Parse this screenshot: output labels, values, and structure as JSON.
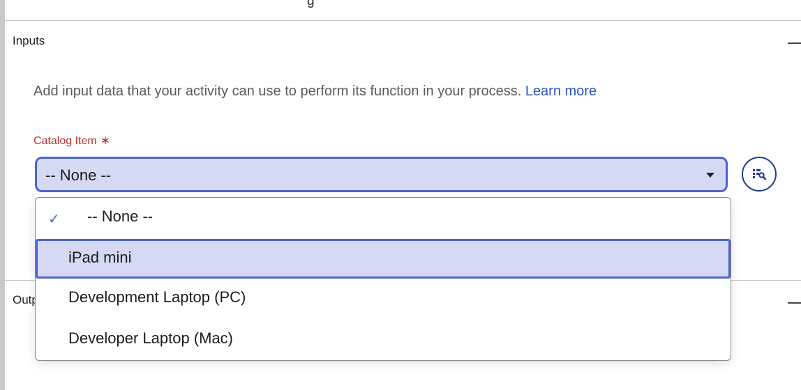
{
  "header": {
    "title_fragment": "g"
  },
  "inputs_section": {
    "title": "Inputs",
    "description": "Add input data that your activity can use to perform its function in your process.",
    "learn_more": "Learn more",
    "field": {
      "label": "Catalog Item",
      "required_mark": "∗",
      "selected_value": "-- None --",
      "options": [
        "-- None --",
        "iPad mini",
        "Development Laptop (PC)",
        "Developer Laptop (Mac)"
      ],
      "checked_index": 0,
      "highlighted_index": 1
    },
    "picker_button_icon": "data-pill-picker-icon"
  },
  "outputs_section": {
    "title": "Outputs"
  },
  "colors": {
    "accent": "#4d63cf",
    "selection_fill": "#d5d9f3",
    "required": "#b3302f",
    "link": "#2b55c7"
  }
}
